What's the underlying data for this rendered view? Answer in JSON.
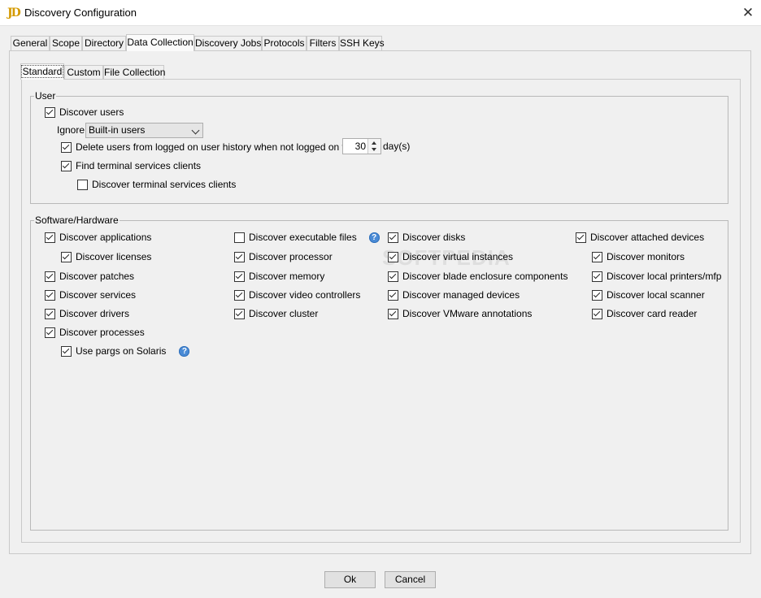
{
  "window": {
    "title": "Discovery Configuration",
    "app_icon": "JD",
    "close_glyph": "✕"
  },
  "tabs": [
    "General",
    "Scope",
    "Directory",
    "Data Collection",
    "Discovery Jobs",
    "Protocols",
    "Filters",
    "SSH Keys"
  ],
  "selected_tab": "Data Collection",
  "subtabs": [
    "Standard",
    "Custom",
    "File Collection"
  ],
  "selected_subtab": "Standard",
  "user_group": {
    "label": "User",
    "discover_users": "Discover users",
    "ignore_label": "Ignore",
    "ignore_value": "Built-in users",
    "delete_users": "Delete users from logged on user history when not logged on for",
    "days_value": "30",
    "days_unit": "day(s)",
    "find_terminal": "Find terminal services clients",
    "discover_terminal": "Discover terminal services clients",
    "checked": {
      "discover_users": true,
      "delete_users": true,
      "find_terminal": true,
      "discover_terminal": false
    }
  },
  "sw_group": {
    "label": "Software/Hardware",
    "col1": [
      {
        "label": "Discover applications",
        "checked": true
      },
      {
        "label": "Discover licenses",
        "checked": true
      },
      {
        "label": "Discover patches",
        "checked": true
      },
      {
        "label": "Discover services",
        "checked": true
      },
      {
        "label": "Discover drivers",
        "checked": true
      },
      {
        "label": "Discover processes",
        "checked": true
      },
      {
        "label": "Use pargs on Solaris",
        "checked": true
      }
    ],
    "col2": [
      {
        "label": "Discover executable files",
        "checked": false
      },
      {
        "label": "Discover processor",
        "checked": true
      },
      {
        "label": "Discover memory",
        "checked": true
      },
      {
        "label": "Discover video controllers",
        "checked": true
      },
      {
        "label": "Discover cluster",
        "checked": true
      }
    ],
    "col3": [
      {
        "label": "Discover disks",
        "checked": true
      },
      {
        "label": "Discover virtual instances",
        "checked": true
      },
      {
        "label": "Discover blade enclosure components",
        "checked": true
      },
      {
        "label": "Discover managed devices",
        "checked": true
      },
      {
        "label": "Discover VMware annotations",
        "checked": true
      }
    ],
    "col4": [
      {
        "label": "Discover attached devices",
        "checked": true
      },
      {
        "label": "Discover monitors",
        "checked": true
      },
      {
        "label": "Discover local printers/mfp",
        "checked": true
      },
      {
        "label": "Discover local scanner",
        "checked": true
      },
      {
        "label": "Discover card reader",
        "checked": true
      }
    ],
    "help_glyph": "?"
  },
  "buttons": {
    "ok": "Ok",
    "cancel": "Cancel"
  },
  "watermark": "SOFTPEDIA"
}
